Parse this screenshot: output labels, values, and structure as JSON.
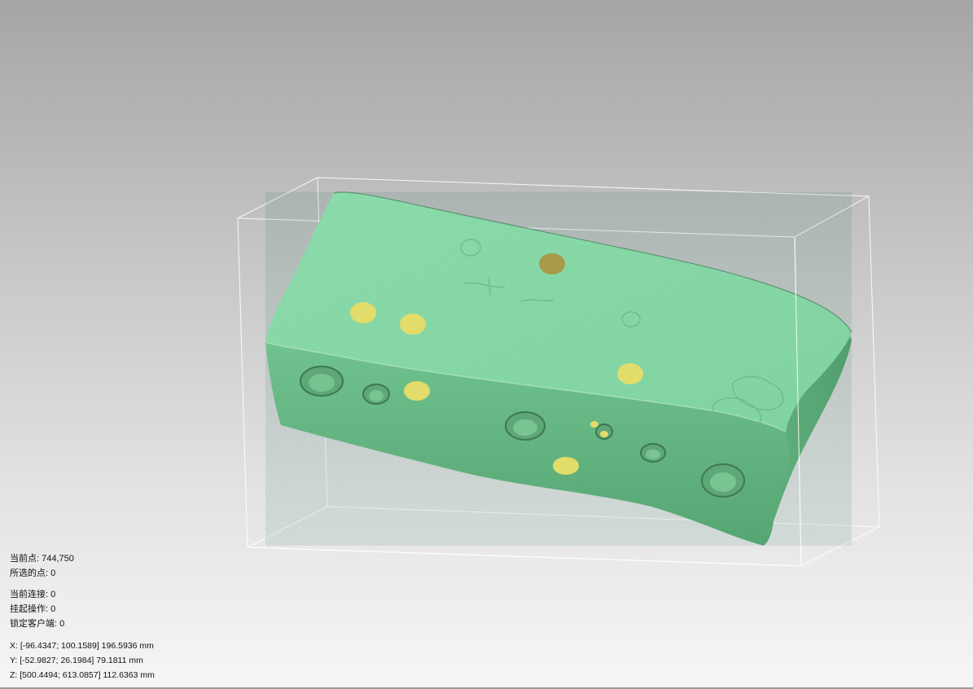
{
  "viewport": {
    "name": "3d-scan-viewport",
    "mesh_color": "#86d8a4",
    "mesh_shadow_color": "#4c9d6c",
    "marker_color": "#e2dc6a",
    "marker_dark_color": "#a79b4a",
    "bbox_color": "#ffffff",
    "background_top": "#a5a5a5",
    "background_bottom": "#f6f6f6"
  },
  "stats": {
    "current_points_label": "当前点:",
    "current_points_value": "744,750",
    "selected_points_label": "所选的点:",
    "selected_points_value": "0"
  },
  "connection": {
    "current_connections_label": "当前连接:",
    "current_connections_value": "0",
    "pending_ops_label": "挂起操作:",
    "pending_ops_value": "0",
    "locked_clients_label": "锁定客户端:",
    "locked_clients_value": "0"
  },
  "coords": {
    "x_label": "X:",
    "x_value": "[-96.4347; 100.1589] 196.5936 mm",
    "y_label": "Y:",
    "y_value": "[-52.9827; 26.1984] 79.1811 mm",
    "z_label": "Z:",
    "z_value": "[500.4494; 613.0857] 112.6363 mm"
  }
}
